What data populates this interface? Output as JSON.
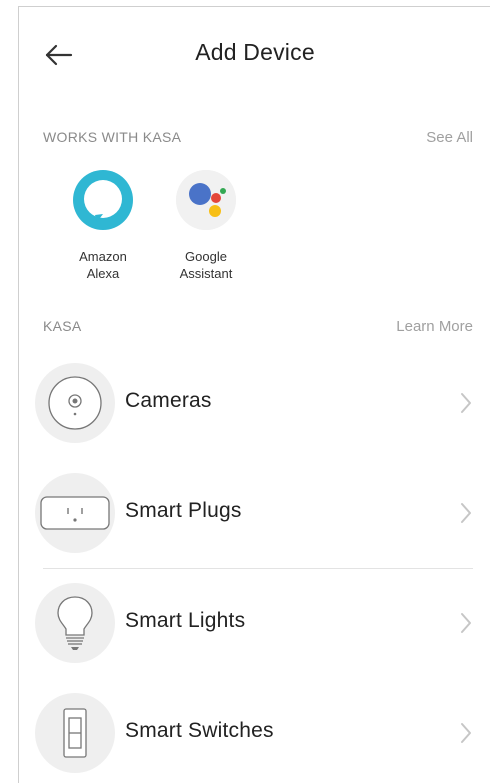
{
  "header": {
    "title": "Add Device"
  },
  "works_with": {
    "section_title": "WORKS WITH KASA",
    "link_label": "See All",
    "items": [
      {
        "label_line1": "Amazon",
        "label_line2": "Alexa",
        "icon": "alexa-icon"
      },
      {
        "label_line1": "Google",
        "label_line2": "Assistant",
        "icon": "google-assistant-icon"
      }
    ]
  },
  "kasa": {
    "section_title": "KASA",
    "link_label": "Learn More",
    "items": [
      {
        "label": "Cameras",
        "icon": "camera-icon"
      },
      {
        "label": "Smart Plugs",
        "icon": "plug-icon"
      },
      {
        "label": "Smart Lights",
        "icon": "bulb-icon"
      },
      {
        "label": "Smart Switches",
        "icon": "switch-icon"
      }
    ]
  },
  "colors": {
    "alexa_ring": "#2fb7d3",
    "google_blue": "#4a73c8",
    "google_red": "#e4463a",
    "google_yellow": "#f7bf16",
    "google_green": "#34a853",
    "icon_bg": "#efefef",
    "muted_text": "#8a8a8a"
  }
}
